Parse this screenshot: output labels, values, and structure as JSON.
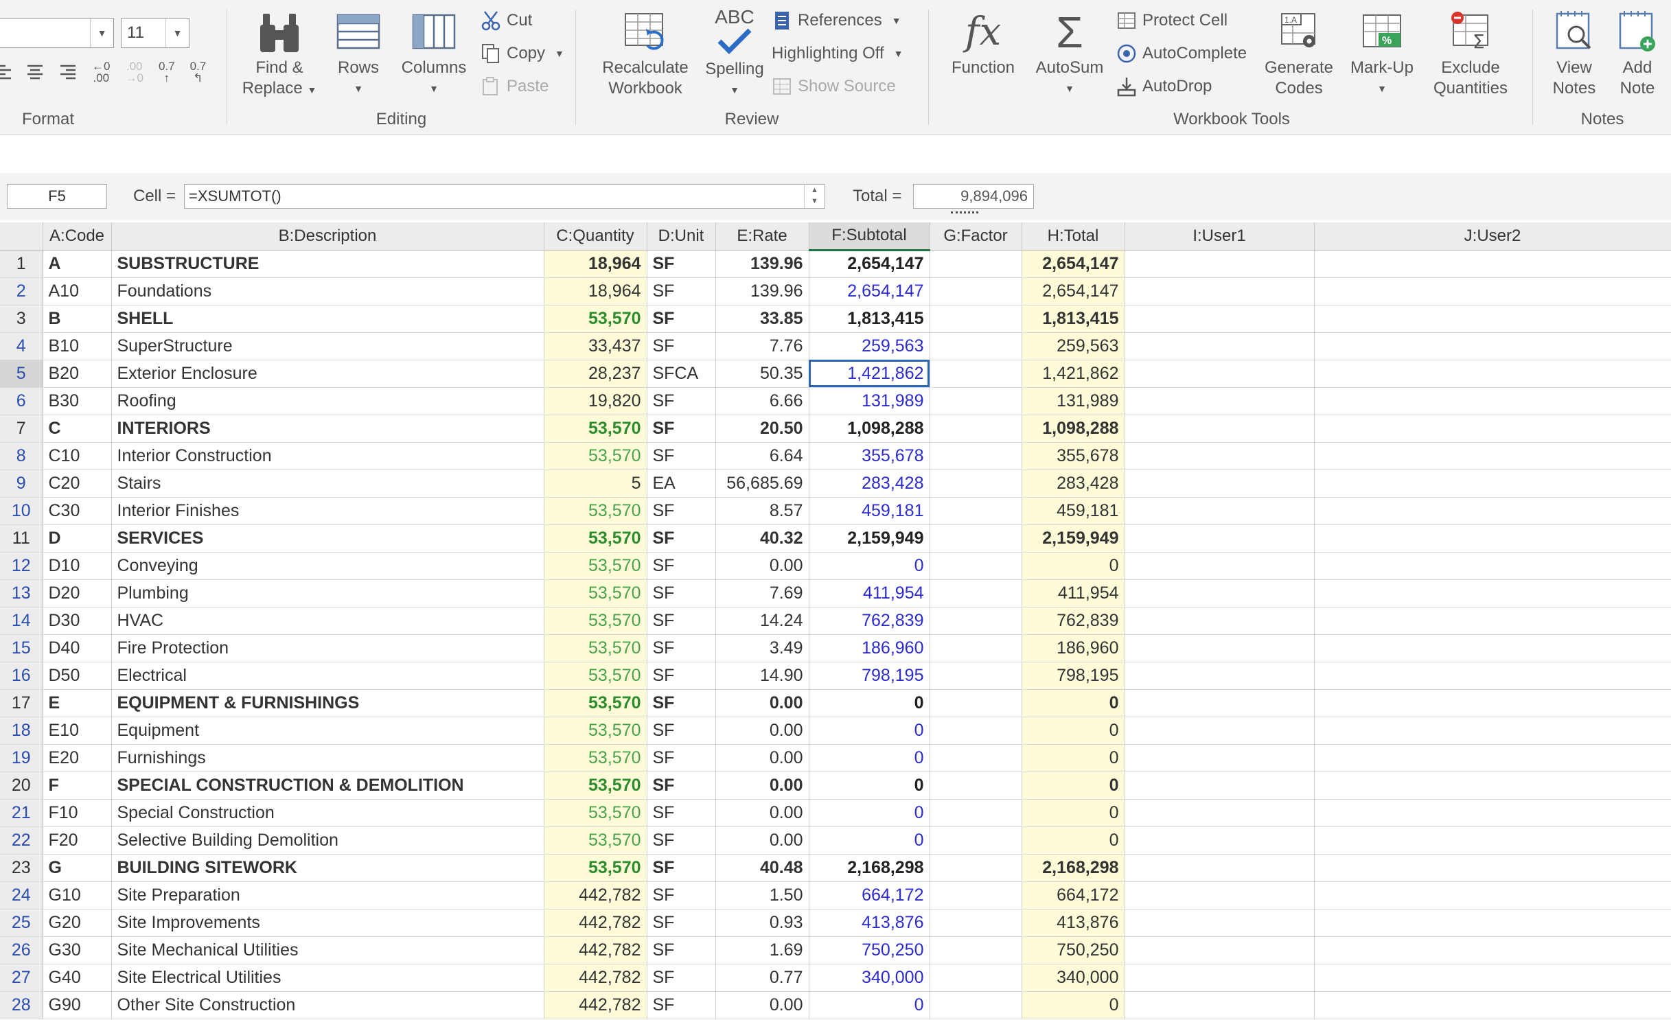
{
  "ribbon": {
    "font_size_value": "11",
    "format": {
      "label": "Format",
      "icons": [
        "align-left-icon",
        "align-center-icon",
        "align-right-icon",
        "increase-decimal-icon",
        "decrease-decimal-icon",
        "decimal-07-icon",
        "decimal-back-icon"
      ],
      "inc_decimal": "←0\n.00",
      "dec_decimal": ".00\n→0",
      "dec07": "0.7",
      "back07": "0.7"
    },
    "editing": {
      "label": "Editing",
      "find_replace": "Find &",
      "find_replace2": "Replace",
      "rows": "Rows",
      "columns": "Columns",
      "cut": "Cut",
      "copy": "Copy",
      "paste": "Paste"
    },
    "review": {
      "label": "Review",
      "recalc1": "Recalculate",
      "recalc2": "Workbook",
      "spelling_top": "ABC",
      "spelling": "Spelling",
      "references": "References",
      "highlighting": "Highlighting Off",
      "show_source": "Show Source"
    },
    "tools": {
      "label": "Workbook Tools",
      "function": "Function",
      "autosum": "AutoSum",
      "protect_cell": "Protect Cell",
      "autocomplete": "AutoComplete",
      "autodrop": "AutoDrop",
      "generate1": "Generate",
      "generate2": "Codes",
      "markup": "Mark-Up",
      "exclude1": "Exclude",
      "exclude2": "Quantities"
    },
    "notes": {
      "label": "Notes",
      "view1": "View",
      "view2": "Notes",
      "add1": "Add",
      "add2": "Note"
    }
  },
  "formula_bar": {
    "name_box": "F5",
    "cell_label": "Cell =",
    "formula": "=XSUMTOT()",
    "total_label": "Total =",
    "total_value": "9,894,096"
  },
  "columns": [
    "A:Code",
    "B:Description",
    "C:Quantity",
    "D:Unit",
    "E:Rate",
    "F:Subtotal",
    "G:Factor",
    "H:Total",
    "I:User1",
    "J:User2"
  ],
  "rows": [
    {
      "n": "1",
      "code": "A",
      "desc": "SUBSTRUCTURE",
      "qty": "18,964",
      "unit": "SF",
      "rate": "139.96",
      "sub": "2,654,147",
      "factor": "",
      "total": "2,654,147",
      "summary": true,
      "green": false
    },
    {
      "n": "2",
      "code": "A10",
      "desc": "Foundations",
      "qty": "18,964",
      "unit": "SF",
      "rate": "139.96",
      "sub": "2,654,147",
      "factor": "",
      "total": "2,654,147",
      "summary": false,
      "green": false
    },
    {
      "n": "3",
      "code": "B",
      "desc": "SHELL",
      "qty": "53,570",
      "unit": "SF",
      "rate": "33.85",
      "sub": "1,813,415",
      "factor": "",
      "total": "1,813,415",
      "summary": true,
      "green": true
    },
    {
      "n": "4",
      "code": "B10",
      "desc": "SuperStructure",
      "qty": "33,437",
      "unit": "SF",
      "rate": "7.76",
      "sub": "259,563",
      "factor": "",
      "total": "259,563",
      "summary": false,
      "green": false
    },
    {
      "n": "5",
      "code": "B20",
      "desc": "Exterior Enclosure",
      "qty": "28,237",
      "unit": "SFCA",
      "rate": "50.35",
      "sub": "1,421,862",
      "factor": "",
      "total": "1,421,862",
      "summary": false,
      "green": false
    },
    {
      "n": "6",
      "code": "B30",
      "desc": "Roofing",
      "qty": "19,820",
      "unit": "SF",
      "rate": "6.66",
      "sub": "131,989",
      "factor": "",
      "total": "131,989",
      "summary": false,
      "green": false
    },
    {
      "n": "7",
      "code": "C",
      "desc": "INTERIORS",
      "qty": "53,570",
      "unit": "SF",
      "rate": "20.50",
      "sub": "1,098,288",
      "factor": "",
      "total": "1,098,288",
      "summary": true,
      "green": true
    },
    {
      "n": "8",
      "code": "C10",
      "desc": "Interior Construction",
      "qty": "53,570",
      "unit": "SF",
      "rate": "6.64",
      "sub": "355,678",
      "factor": "",
      "total": "355,678",
      "summary": false,
      "green": true
    },
    {
      "n": "9",
      "code": "C20",
      "desc": "Stairs",
      "qty": "5",
      "unit": "EA",
      "rate": "56,685.69",
      "sub": "283,428",
      "factor": "",
      "total": "283,428",
      "summary": false,
      "green": false
    },
    {
      "n": "10",
      "code": "C30",
      "desc": "Interior Finishes",
      "qty": "53,570",
      "unit": "SF",
      "rate": "8.57",
      "sub": "459,181",
      "factor": "",
      "total": "459,181",
      "summary": false,
      "green": true
    },
    {
      "n": "11",
      "code": "D",
      "desc": "SERVICES",
      "qty": "53,570",
      "unit": "SF",
      "rate": "40.32",
      "sub": "2,159,949",
      "factor": "",
      "total": "2,159,949",
      "summary": true,
      "green": true
    },
    {
      "n": "12",
      "code": "D10",
      "desc": "Conveying",
      "qty": "53,570",
      "unit": "SF",
      "rate": "0.00",
      "sub": "0",
      "factor": "",
      "total": "0",
      "summary": false,
      "green": true
    },
    {
      "n": "13",
      "code": "D20",
      "desc": "Plumbing",
      "qty": "53,570",
      "unit": "SF",
      "rate": "7.69",
      "sub": "411,954",
      "factor": "",
      "total": "411,954",
      "summary": false,
      "green": true
    },
    {
      "n": "14",
      "code": "D30",
      "desc": "HVAC",
      "qty": "53,570",
      "unit": "SF",
      "rate": "14.24",
      "sub": "762,839",
      "factor": "",
      "total": "762,839",
      "summary": false,
      "green": true
    },
    {
      "n": "15",
      "code": "D40",
      "desc": "Fire Protection",
      "qty": "53,570",
      "unit": "SF",
      "rate": "3.49",
      "sub": "186,960",
      "factor": "",
      "total": "186,960",
      "summary": false,
      "green": true
    },
    {
      "n": "16",
      "code": "D50",
      "desc": "Electrical",
      "qty": "53,570",
      "unit": "SF",
      "rate": "14.90",
      "sub": "798,195",
      "factor": "",
      "total": "798,195",
      "summary": false,
      "green": true
    },
    {
      "n": "17",
      "code": "E",
      "desc": "EQUIPMENT & FURNISHINGS",
      "qty": "53,570",
      "unit": "SF",
      "rate": "0.00",
      "sub": "0",
      "factor": "",
      "total": "0",
      "summary": true,
      "green": true
    },
    {
      "n": "18",
      "code": "E10",
      "desc": "Equipment",
      "qty": "53,570",
      "unit": "SF",
      "rate": "0.00",
      "sub": "0",
      "factor": "",
      "total": "0",
      "summary": false,
      "green": true
    },
    {
      "n": "19",
      "code": "E20",
      "desc": "Furnishings",
      "qty": "53,570",
      "unit": "SF",
      "rate": "0.00",
      "sub": "0",
      "factor": "",
      "total": "0",
      "summary": false,
      "green": true
    },
    {
      "n": "20",
      "code": "F",
      "desc": "SPECIAL CONSTRUCTION & DEMOLITION",
      "qty": "53,570",
      "unit": "SF",
      "rate": "0.00",
      "sub": "0",
      "factor": "",
      "total": "0",
      "summary": true,
      "green": true
    },
    {
      "n": "21",
      "code": "F10",
      "desc": "Special Construction",
      "qty": "53,570",
      "unit": "SF",
      "rate": "0.00",
      "sub": "0",
      "factor": "",
      "total": "0",
      "summary": false,
      "green": true
    },
    {
      "n": "22",
      "code": "F20",
      "desc": "Selective Building Demolition",
      "qty": "53,570",
      "unit": "SF",
      "rate": "0.00",
      "sub": "0",
      "factor": "",
      "total": "0",
      "summary": false,
      "green": true
    },
    {
      "n": "23",
      "code": "G",
      "desc": "BUILDING SITEWORK",
      "qty": "53,570",
      "unit": "SF",
      "rate": "40.48",
      "sub": "2,168,298",
      "factor": "",
      "total": "2,168,298",
      "summary": true,
      "green": true
    },
    {
      "n": "24",
      "code": "G10",
      "desc": "Site Preparation",
      "qty": "442,782",
      "unit": "SF",
      "rate": "1.50",
      "sub": "664,172",
      "factor": "",
      "total": "664,172",
      "summary": false,
      "green": false
    },
    {
      "n": "25",
      "code": "G20",
      "desc": "Site Improvements",
      "qty": "442,782",
      "unit": "SF",
      "rate": "0.93",
      "sub": "413,876",
      "factor": "",
      "total": "413,876",
      "summary": false,
      "green": false
    },
    {
      "n": "26",
      "code": "G30",
      "desc": "Site Mechanical Utilities",
      "qty": "442,782",
      "unit": "SF",
      "rate": "1.69",
      "sub": "750,250",
      "factor": "",
      "total": "750,250",
      "summary": false,
      "green": false
    },
    {
      "n": "27",
      "code": "G40",
      "desc": "Site Electrical Utilities",
      "qty": "442,782",
      "unit": "SF",
      "rate": "0.77",
      "sub": "340,000",
      "factor": "",
      "total": "340,000",
      "summary": false,
      "green": false
    },
    {
      "n": "28",
      "code": "G90",
      "desc": "Other Site Construction",
      "qty": "442,782",
      "unit": "SF",
      "rate": "0.00",
      "sub": "0",
      "factor": "",
      "total": "0",
      "summary": false,
      "green": false
    }
  ],
  "selected_row": "5",
  "colors": {
    "accent": "#217346",
    "selection": "#2a66b8",
    "link_blue": "#2b2bd0",
    "qty_green": "#4aa24a",
    "cell_yellow": "#fdfbd8"
  }
}
